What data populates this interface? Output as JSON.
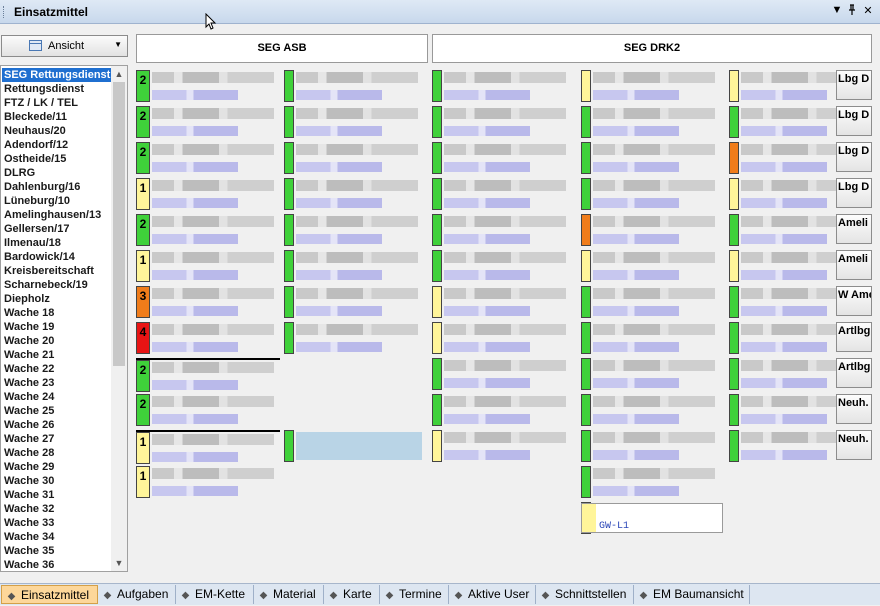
{
  "window": {
    "title": "Einsatzmittel",
    "pin_glyph": "▼",
    "pin2_glyph": "ᛘ",
    "close_glyph": "✕"
  },
  "view_dropdown": {
    "label": "Ansicht"
  },
  "sidebar": {
    "items": [
      "SEG Rettungsdienst",
      "Rettungsdienst",
      "FTZ / LK / TEL",
      "Bleckede/11",
      "Neuhaus/20",
      "Adendorf/12",
      "Ostheide/15",
      "DLRG",
      "Dahlenburg/16",
      "Lüneburg/10",
      "Amelinghausen/13",
      "Gellersen/17",
      "Ilmenau/18",
      "Bardowick/14",
      "Kreisbereitschaft",
      "Scharnebeck/19",
      "Diepholz",
      "Wache 18",
      "Wache 19",
      "Wache 20",
      "Wache 21",
      "Wache 22",
      "Wache 23",
      "Wache 24",
      "Wache 25",
      "Wache 26",
      "Wache 27",
      "Wache 28",
      "Wache 29",
      "Wache 30",
      "Wache 31",
      "Wache 32",
      "Wache 33",
      "Wache 34",
      "Wache 35",
      "Wache 36"
    ]
  },
  "groups": [
    {
      "label": "SEG ASB"
    },
    {
      "label": "SEG DRK2"
    }
  ],
  "status_numbers": [
    "2",
    "2",
    "2",
    "1",
    "2",
    "1",
    "3",
    "4",
    "2",
    "2",
    "1",
    "1"
  ],
  "status_colors": {
    "green": "#3fd13a",
    "yellow": "#fff59a",
    "orange": "#f07c1a",
    "red": "#e81414"
  },
  "gw_card": {
    "label": "GW-L1"
  },
  "right_buttons": [
    "Lbg D",
    "Lbg D",
    "Lbg D",
    "Lbg D",
    "Ameli",
    "Ameli",
    "W Ame",
    "Artlbg",
    "Artlbg",
    "Neuh.",
    "Neuh."
  ],
  "tabs": [
    {
      "label": "Einsatzmittel",
      "icon": "vehicle-icon"
    },
    {
      "label": "Aufgaben",
      "icon": "tasks-icon"
    },
    {
      "label": "EM-Kette",
      "icon": "chain-icon"
    },
    {
      "label": "Material",
      "icon": "material-icon"
    },
    {
      "label": "Karte",
      "icon": "map-icon"
    },
    {
      "label": "Termine",
      "icon": "clock-icon"
    },
    {
      "label": "Aktive User",
      "icon": "users-icon"
    },
    {
      "label": "Schnittstellen",
      "icon": "interface-icon"
    },
    {
      "label": "EM Baumansicht",
      "icon": "tree-icon"
    }
  ]
}
